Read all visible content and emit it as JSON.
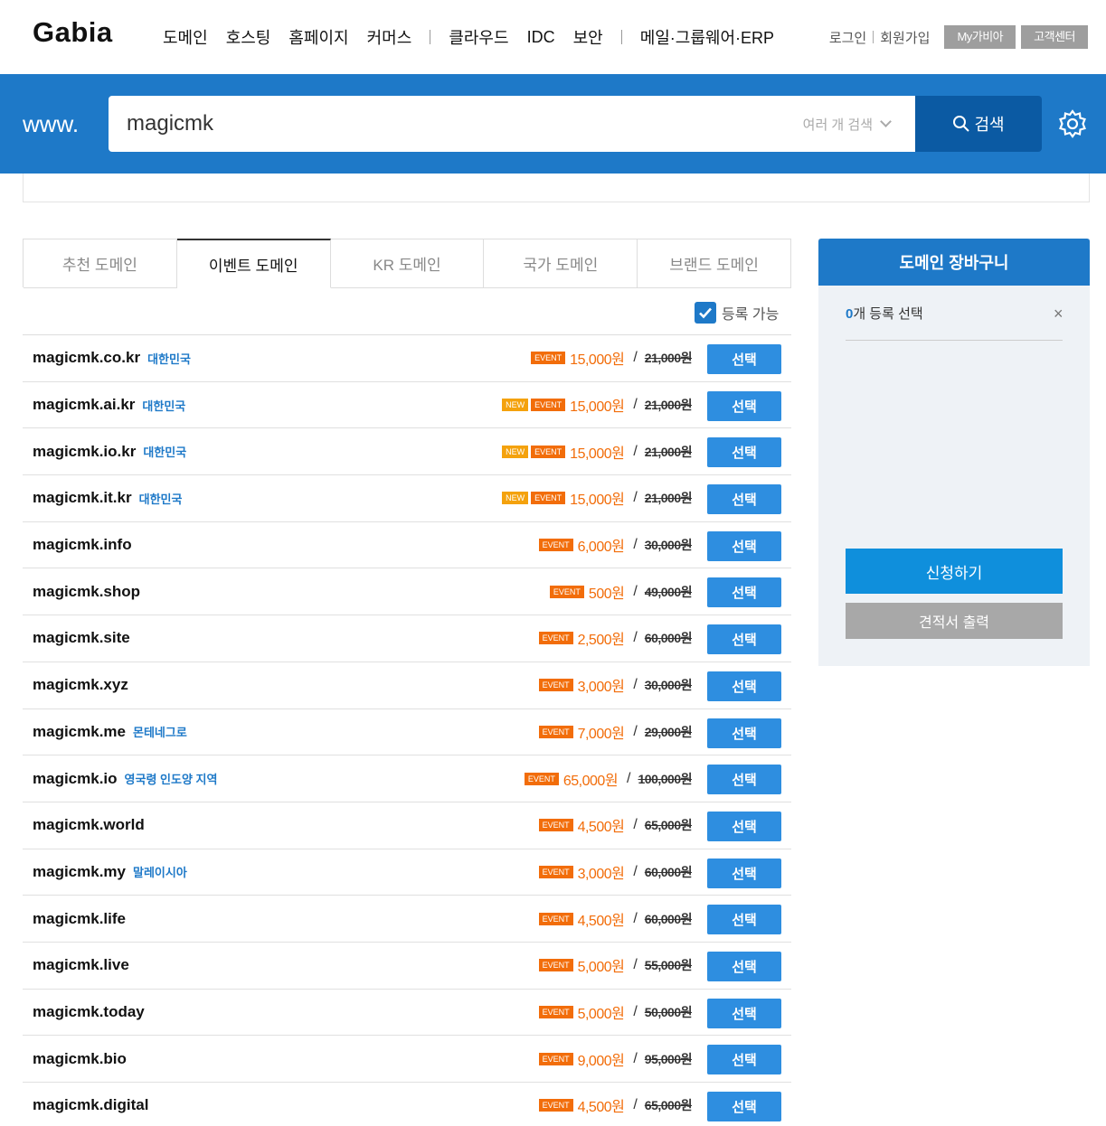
{
  "header": {
    "logo": "Gabia",
    "nav": [
      "도메인",
      "호스팅",
      "홈페이지",
      "커머스",
      "클라우드",
      "IDC",
      "보안",
      "메일·그룹웨어·ERP"
    ],
    "login": "로그인",
    "signup": "회원가입",
    "my_gabia": "My가비아",
    "support": "고객센터"
  },
  "search": {
    "prefix": "www.",
    "value": "magicmk",
    "multi_label": "여러 개 검색",
    "button_label": "검색"
  },
  "tabs": [
    "추천 도메인",
    "이벤트 도메인",
    "KR 도메인",
    "국가 도메인",
    "브랜드 도메인"
  ],
  "active_tab": "이벤트 도메인",
  "filter": {
    "label": "등록 가능",
    "checked": true
  },
  "domains": [
    {
      "name": "magicmk.co.kr",
      "country": "대한민국",
      "new": false,
      "event": true,
      "price": "15,000원",
      "original": "21,000원"
    },
    {
      "name": "magicmk.ai.kr",
      "country": "대한민국",
      "new": true,
      "event": true,
      "price": "15,000원",
      "original": "21,000원"
    },
    {
      "name": "magicmk.io.kr",
      "country": "대한민국",
      "new": true,
      "event": true,
      "price": "15,000원",
      "original": "21,000원"
    },
    {
      "name": "magicmk.it.kr",
      "country": "대한민국",
      "new": true,
      "event": true,
      "price": "15,000원",
      "original": "21,000원"
    },
    {
      "name": "magicmk.info",
      "country": "",
      "new": false,
      "event": true,
      "price": "6,000원",
      "original": "30,000원"
    },
    {
      "name": "magicmk.shop",
      "country": "",
      "new": false,
      "event": true,
      "price": "500원",
      "original": "49,000원"
    },
    {
      "name": "magicmk.site",
      "country": "",
      "new": false,
      "event": true,
      "price": "2,500원",
      "original": "60,000원"
    },
    {
      "name": "magicmk.xyz",
      "country": "",
      "new": false,
      "event": true,
      "price": "3,000원",
      "original": "30,000원"
    },
    {
      "name": "magicmk.me",
      "country": "몬테네그로",
      "new": false,
      "event": true,
      "price": "7,000원",
      "original": "29,000원"
    },
    {
      "name": "magicmk.io",
      "country": "영국령 인도양 지역",
      "new": false,
      "event": true,
      "price": "65,000원",
      "original": "100,000원"
    },
    {
      "name": "magicmk.world",
      "country": "",
      "new": false,
      "event": true,
      "price": "4,500원",
      "original": "65,000원"
    },
    {
      "name": "magicmk.my",
      "country": "말레이시아",
      "new": false,
      "event": true,
      "price": "3,000원",
      "original": "60,000원"
    },
    {
      "name": "magicmk.life",
      "country": "",
      "new": false,
      "event": true,
      "price": "4,500원",
      "original": "60,000원"
    },
    {
      "name": "magicmk.live",
      "country": "",
      "new": false,
      "event": true,
      "price": "5,000원",
      "original": "55,000원"
    },
    {
      "name": "magicmk.today",
      "country": "",
      "new": false,
      "event": true,
      "price": "5,000원",
      "original": "50,000원"
    },
    {
      "name": "magicmk.bio",
      "country": "",
      "new": false,
      "event": true,
      "price": "9,000원",
      "original": "95,000원"
    },
    {
      "name": "magicmk.digital",
      "country": "",
      "new": false,
      "event": true,
      "price": "4,500원",
      "original": "65,000원"
    }
  ],
  "badges": {
    "new": "NEW",
    "event": "EVENT"
  },
  "slash": "/",
  "select_label": "선택",
  "cart": {
    "title": "도메인 장바구니",
    "count": "0",
    "count_suffix": "개 등록 선택",
    "close": "×",
    "apply_label": "신청하기",
    "quote_label": "견적서 출력"
  },
  "colors": {
    "brand_blue": "#1e79c8",
    "search_button": "#0b5aa3",
    "event_orange": "#f26d0a",
    "new_yellow": "#f4a20d",
    "select_button": "#2e8ee0"
  }
}
